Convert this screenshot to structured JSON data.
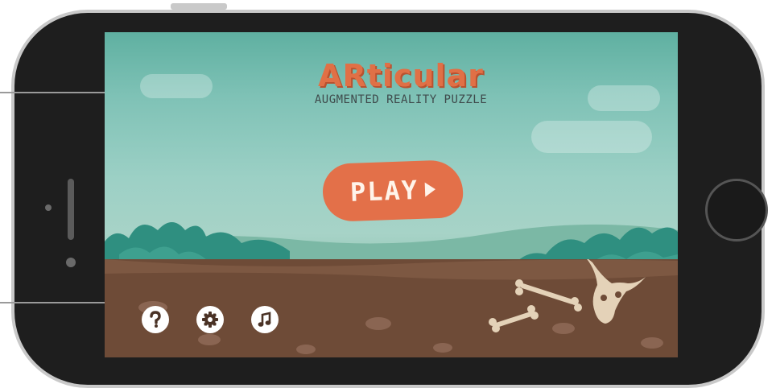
{
  "game": {
    "title": "ARticular",
    "subtitle": "AUGMENTED REALITY PUZZLE",
    "play_label": "PLAY"
  },
  "toolbar": {
    "help_icon": "question-icon",
    "settings_icon": "gear-icon",
    "music_icon": "music-note-icon"
  },
  "colors": {
    "accent": "#e37049",
    "sky": "#7fc2b6",
    "ground": "#6e4b37",
    "bushes": "#2f8f80"
  }
}
